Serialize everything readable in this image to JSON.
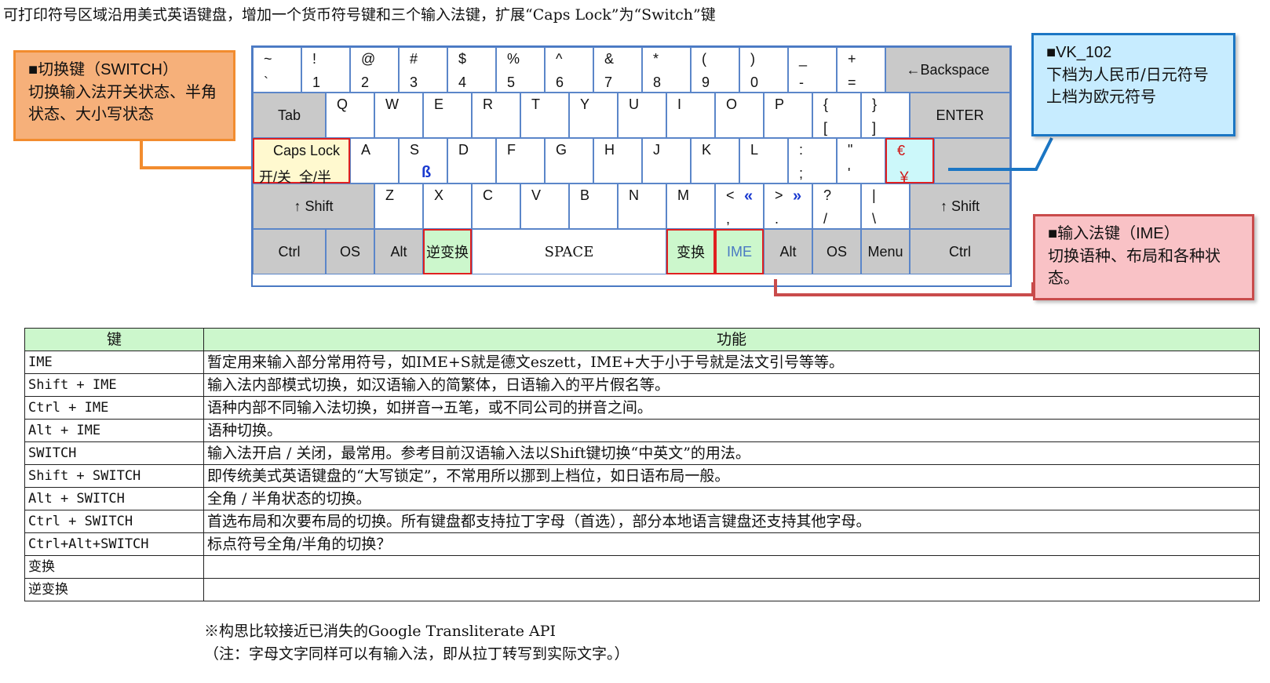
{
  "title": "可打印符号区域沿用美式英语键盘，增加一个货币符号键和三个输入法键，扩展“Caps Lock”为“Switch”键",
  "callouts": {
    "switch": {
      "title": "■切换键（SWITCH）",
      "body": "切换输入法开关状态、半角状态、大小写状态"
    },
    "vk102": {
      "title": "■VK_102",
      "line1": "下档为人民币/日元符号",
      "line2": "上档为欧元符号"
    },
    "ime": {
      "title": "■输入法键（IME）",
      "body": "切换语种、布局和各种状态。"
    }
  },
  "keys": {
    "row1": [
      {
        "top": "~",
        "bottom": "`"
      },
      {
        "top": "!",
        "bottom": "1"
      },
      {
        "top": "@",
        "bottom": "2"
      },
      {
        "top": "#",
        "bottom": "3"
      },
      {
        "top": "$",
        "bottom": "4"
      },
      {
        "top": "%",
        "bottom": "5"
      },
      {
        "top": "^",
        "bottom": "6"
      },
      {
        "top": "&",
        "bottom": "7"
      },
      {
        "top": "*",
        "bottom": "8"
      },
      {
        "top": "(",
        "bottom": "9"
      },
      {
        "top": ")",
        "bottom": "0"
      },
      {
        "top": "_",
        "bottom": "-"
      },
      {
        "top": "+",
        "bottom": "="
      }
    ],
    "backspace": "←Backspace",
    "tab": "Tab",
    "row2": [
      "Q",
      "W",
      "E",
      "R",
      "T",
      "Y",
      "U",
      "I",
      "O",
      "P"
    ],
    "bracket": {
      "top": "{",
      "bottom": "["
    },
    "brace": {
      "top": "}",
      "bottom": "]"
    },
    "enter": "ENTER",
    "capslock": {
      "label": "Caps Lock",
      "sub": "开/关  全/半"
    },
    "row3": [
      "A",
      "S",
      "D",
      "F",
      "G",
      "H",
      "J",
      "K",
      "L"
    ],
    "eszett": "ß",
    "colon": {
      "top": ":",
      "bottom": ";"
    },
    "quote": {
      "top": "\"",
      "bottom": "'"
    },
    "vk102": {
      "top": "€",
      "bottom": "￥"
    },
    "shift": "↑ Shift",
    "row4": [
      "Z",
      "X",
      "C",
      "V",
      "B",
      "N",
      "M"
    ],
    "lt": {
      "top": "<",
      "bottom": ",",
      "extra": "«"
    },
    "gt": {
      "top": ">",
      "bottom": ".",
      "extra": "»"
    },
    "question": {
      "top": "?",
      "bottom": "/"
    },
    "pipe": {
      "top": "|",
      "bottom": "\\"
    },
    "row5": {
      "ctrl": "Ctrl",
      "os": "OS",
      "alt": "Alt",
      "inverse": "逆变换",
      "space": "SPACE",
      "convert": "变换",
      "ime": "IME",
      "menu": "Menu"
    }
  },
  "table": {
    "headers": [
      "键",
      "功能"
    ],
    "rows": [
      [
        "IME",
        "暂定用来输入部分常用符号，如IME+S就是德文eszett，IME+大于小于号就是法文引号等等。"
      ],
      [
        "Shift + IME",
        "输入法内部模式切换，如汉语输入的简繁体，日语输入的平片假名等。"
      ],
      [
        "Ctrl + IME",
        "语种内部不同输入法切换，如拼音→五笔，或不同公司的拼音之间。"
      ],
      [
        "Alt + IME",
        "语种切换。"
      ],
      [
        "SWITCH",
        "输入法开启 / 关闭，最常用。参考目前汉语输入法以Shift键切换“中英文”的用法。"
      ],
      [
        "Shift + SWITCH",
        "即传统美式英语键盘的“大写锁定”，不常用所以挪到上档位，如日语布局一般。"
      ],
      [
        "Alt + SWITCH",
        "全角 / 半角状态的切换。"
      ],
      [
        "Ctrl + SWITCH",
        "首选布局和次要布局的切换。所有键盘都支持拉丁字母（首选），部分本地语言键盘还支持其他字母。"
      ],
      [
        "Ctrl+Alt+SWITCH",
        "标点符号全角/半角的切换？"
      ],
      [
        "变换",
        ""
      ],
      [
        "逆变换",
        ""
      ]
    ]
  },
  "notes": {
    "line1": "※构思比较接近已消失的Google Transliterate API",
    "line2": "（注：字母文字同样可以有输入法，即从拉丁转写到实际文字。）"
  },
  "colors": {
    "keyBorder": "#5b86c9",
    "gray": "#c9c9c9",
    "green": "#ccf7cc",
    "cyan": "#ccf8fa",
    "orange": "#f28c2f",
    "blue": "#1b76c4",
    "red": "#c94b4b",
    "highlightRed": "#e02020"
  }
}
